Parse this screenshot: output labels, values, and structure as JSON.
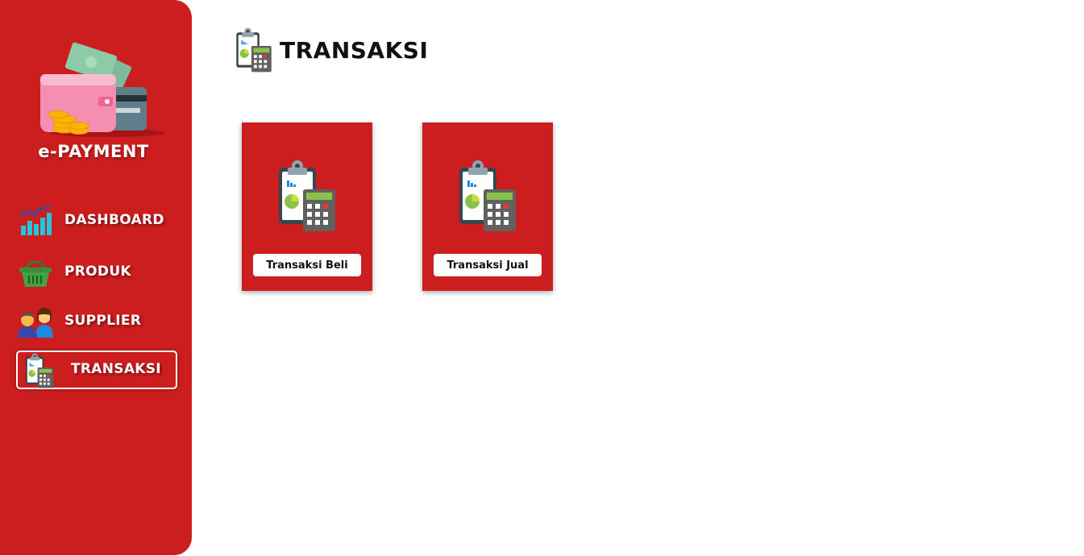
{
  "brand": {
    "name": "e-PAYMENT",
    "logo_icon": "wallet-money-icon"
  },
  "sidebar": {
    "items": [
      {
        "label": "DASHBOARD",
        "icon": "bar-chart-icon",
        "active": false
      },
      {
        "label": "PRODUK",
        "icon": "shopping-basket-icon",
        "active": false
      },
      {
        "label": "SUPPLIER",
        "icon": "people-icon",
        "active": false
      },
      {
        "label": "TRANSAKSI",
        "icon": "clipboard-calculator-icon",
        "active": true
      }
    ]
  },
  "header": {
    "title": "TRANSAKSI",
    "icon": "clipboard-calculator-icon"
  },
  "cards": [
    {
      "label": "Transaksi Beli",
      "icon": "clipboard-calculator-icon"
    },
    {
      "label": "Transaksi Jual",
      "icon": "clipboard-calculator-icon"
    }
  ],
  "colors": {
    "primary": "#cc1d1f",
    "background": "#ffffff",
    "text_dark": "#111111",
    "text_light": "#ffffff"
  }
}
